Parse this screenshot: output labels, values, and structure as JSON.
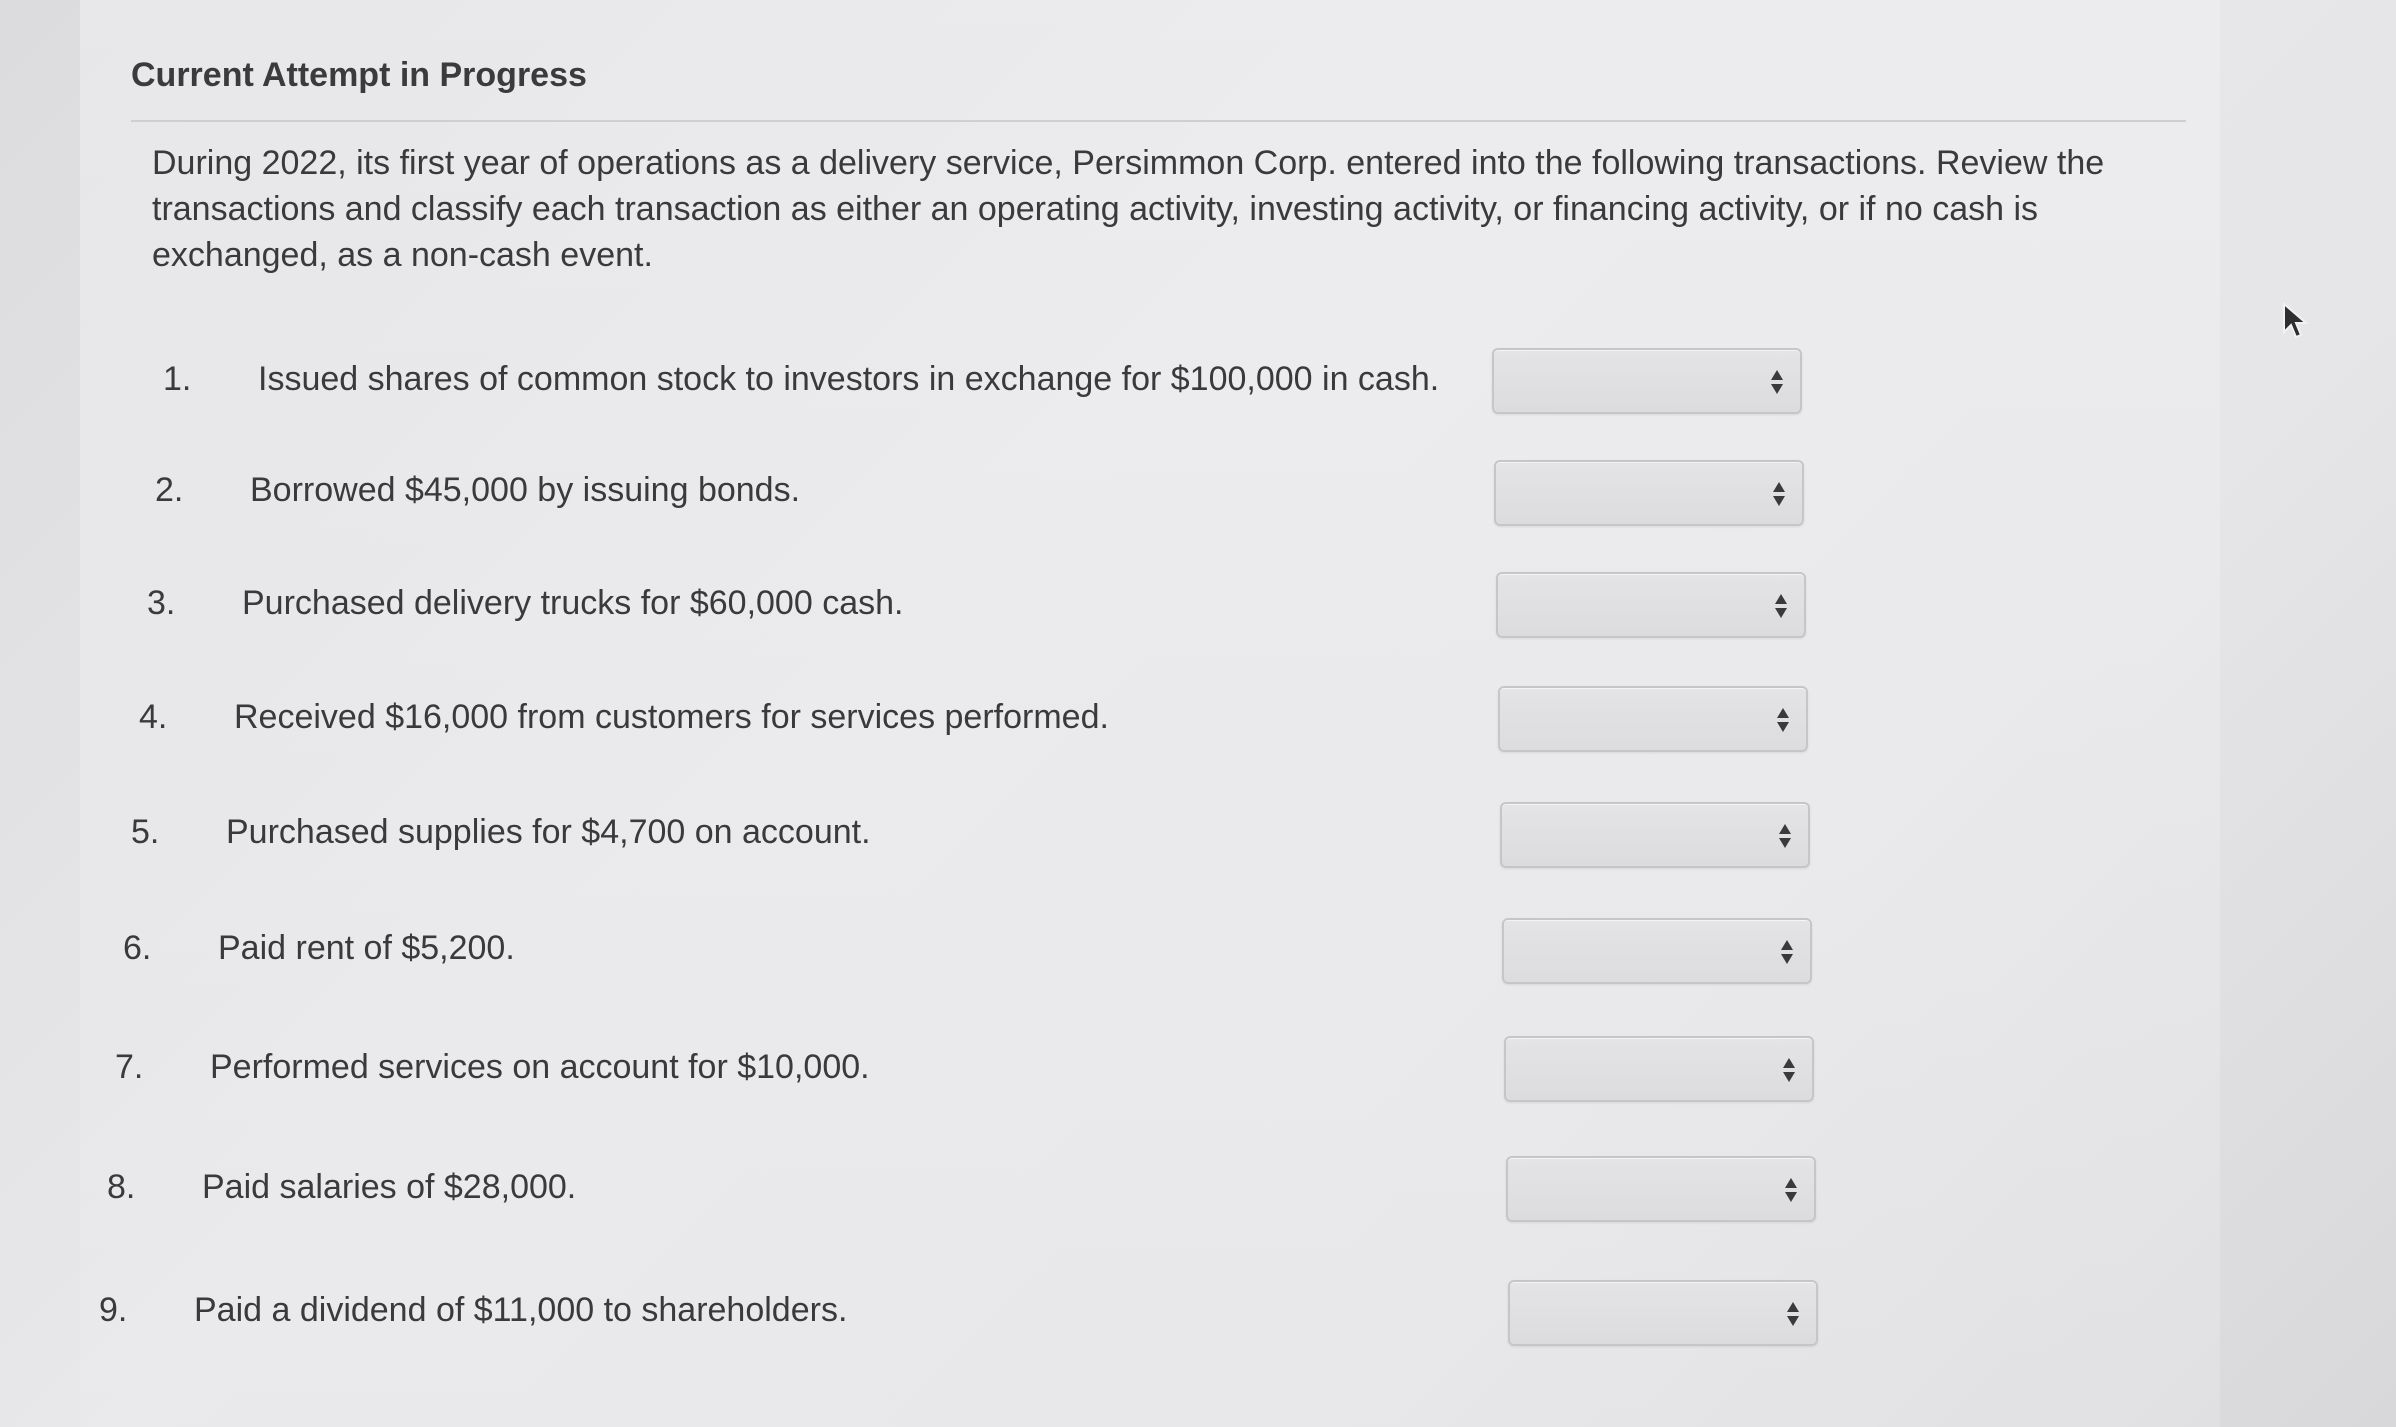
{
  "header": {
    "title": "Current Attempt in Progress"
  },
  "instructions": "During 2022, its first year of operations as a delivery service, Persimmon Corp. entered into the following transactions. Review the transactions and classify each transaction as either an operating activity, investing activity, or financing activity, or if no cash is exchanged, as a non-cash event.",
  "questions": [
    {
      "number": "1.",
      "text": "Issued shares of common stock to investors in exchange for $100,000 in cash.",
      "selected": ""
    },
    {
      "number": "2.",
      "text": "Borrowed $45,000 by issuing bonds.",
      "selected": ""
    },
    {
      "number": "3.",
      "text": "Purchased delivery trucks for $60,000 cash.",
      "selected": ""
    },
    {
      "number": "4.",
      "text": "Received $16,000 from customers for services performed.",
      "selected": ""
    },
    {
      "number": "5.",
      "text": "Purchased supplies for $4,700 on account.",
      "selected": ""
    },
    {
      "number": "6.",
      "text": "Paid rent of $5,200.",
      "selected": ""
    },
    {
      "number": "7.",
      "text": "Performed services on account for $10,000.",
      "selected": ""
    },
    {
      "number": "8.",
      "text": "Paid salaries of $28,000.",
      "selected": ""
    },
    {
      "number": "9.",
      "text": "Paid a dividend of $11,000 to shareholders.",
      "selected": ""
    }
  ],
  "icons": {
    "select_arrow": "sort-arrows-icon",
    "cursor": "mouse-pointer-icon"
  }
}
